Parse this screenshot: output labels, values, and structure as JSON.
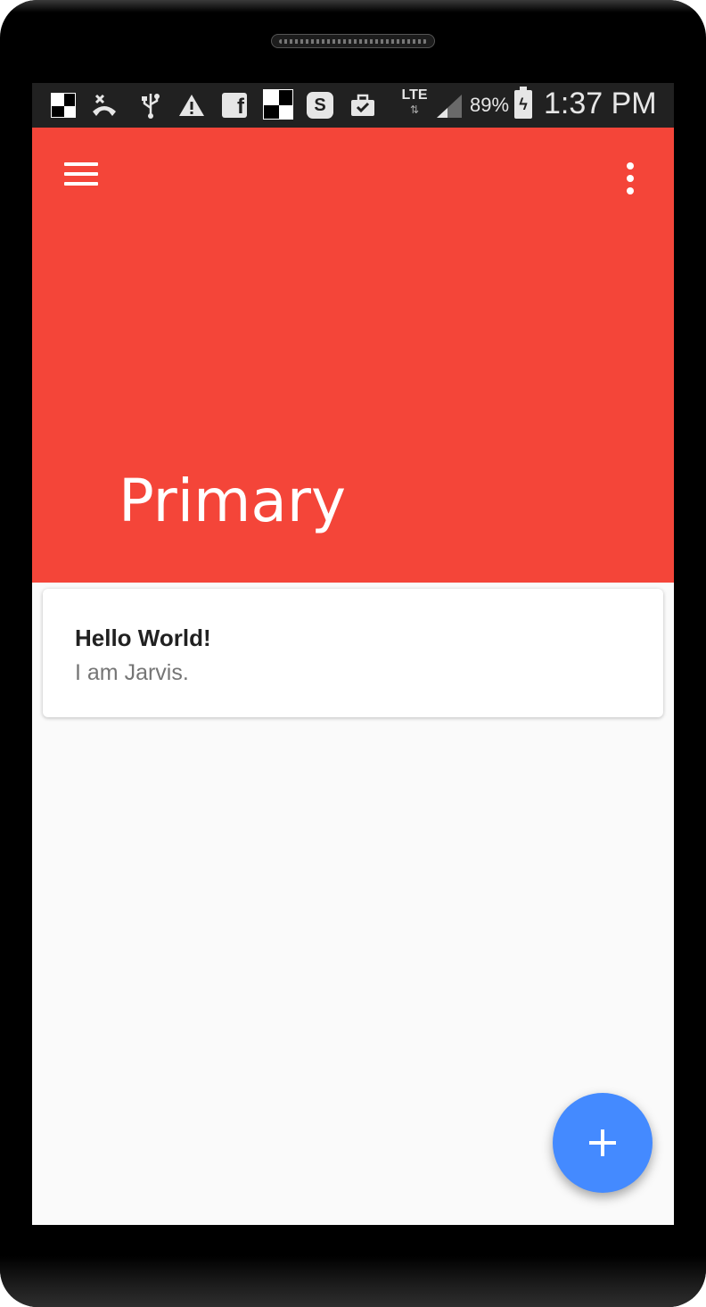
{
  "status_bar": {
    "network": "LTE",
    "battery_percent": "89%",
    "time": "1:37 PM",
    "notification_icons": [
      "checker-icon",
      "missed-call-icon",
      "usb-icon",
      "warning-icon",
      "facebook-icon",
      "checker-icon",
      "skype-icon",
      "briefcase-check-icon"
    ]
  },
  "app_bar": {
    "title": "Primary",
    "color": "#f44539",
    "menu_icon": "hamburger-menu-icon",
    "overflow_icon": "more-vert-icon"
  },
  "cards": [
    {
      "title": "Hello World!",
      "text": "I am Jarvis."
    }
  ],
  "fab": {
    "icon": "plus-icon",
    "color": "#448aff"
  }
}
